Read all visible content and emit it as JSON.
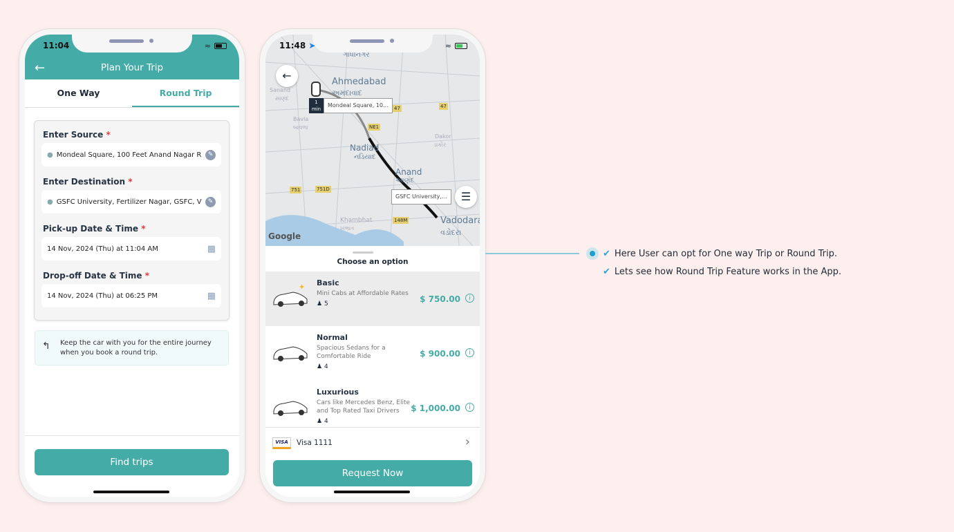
{
  "phone1": {
    "time": "11:04",
    "header": {
      "title": "Plan Your Trip"
    },
    "tabs": [
      {
        "label": "One Way",
        "active": false
      },
      {
        "label": "Round Trip",
        "active": true
      }
    ],
    "fields": [
      {
        "label": "Enter Source",
        "value": "Mondeal Square, 100 Feet Anand Nagar R...",
        "icon": "location-pin-icon",
        "action_icon": "pencil-icon"
      },
      {
        "label": "Enter Destination",
        "value": "GSFC University, Fertilizer Nagar, GSFC, Vi...",
        "icon": "location-pin-icon",
        "action_icon": "pencil-icon"
      },
      {
        "label": "Pick-up Date & Time",
        "value": "14 Nov, 2024 (Thu) at 11:04 AM",
        "action_icon": "calendar-icon"
      },
      {
        "label": "Drop-off Date & Time",
        "value": "14 Nov, 2024 (Thu) at 06:25 PM",
        "action_icon": "calendar-icon"
      }
    ],
    "required_mark": "*",
    "note": "Keep the car with you for the entire journey when you book a round trip.",
    "cta": "Find trips"
  },
  "phone2": {
    "time": "11:48",
    "map": {
      "labels": [
        "ગાંધીનગર",
        "Ahmedabad",
        "અમદાવાદ",
        "Sanand",
        "સાણંદ",
        "Bavla",
        "બાવળા",
        "Nadiad",
        "નડિયાદ",
        "Anand",
        "આણંદ",
        "Dakor",
        "ડાકોર",
        "Khambhat",
        "ખંભાત",
        "Vadodara",
        "વડોદરા"
      ],
      "shields": [
        "47",
        "47",
        "NE1",
        "751",
        "751D",
        "148M"
      ],
      "pickup_eta": "1",
      "pickup_eta_unit": "min",
      "pickup_label": "Mondeal Square, 10...",
      "drop_label": "GSFC University,...",
      "attribution": "Google"
    },
    "sheet_title": "Choose an option",
    "options": [
      {
        "name": "Basic",
        "desc": "Mini Cabs at Affordable Rates",
        "seats": "5",
        "price": "$ 750.00",
        "selected": true
      },
      {
        "name": "Normal",
        "desc": "Spacious Sedans for a Comfortable Ride",
        "seats": "4",
        "price": "$ 900.00",
        "selected": false
      },
      {
        "name": "Luxurious",
        "desc": "Cars like Mercedes Benz, Elite and Top Rated Taxi Drivers",
        "seats": "4",
        "price": "$ 1,000.00",
        "selected": false
      }
    ],
    "payment": {
      "brand": "VISA",
      "label": "Visa 1111"
    },
    "cta": "Request Now"
  },
  "annotation": {
    "points": [
      "Here User can opt for One way Trip or Round Trip.",
      "Lets see how Round Trip Feature works in the App."
    ]
  },
  "colors": {
    "accent": "#45aba6",
    "background": "#fdefed",
    "check": "#2aa3cf"
  }
}
